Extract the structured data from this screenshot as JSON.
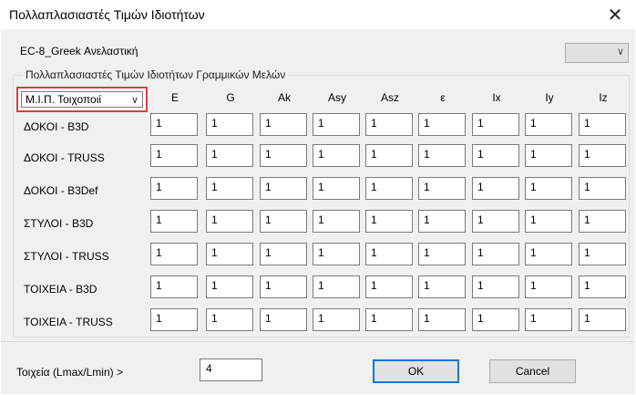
{
  "window": {
    "title": "Πολλαπλασιαστές Τιμών Ιδιοτήτων",
    "close_glyph": "✕"
  },
  "profile": {
    "label": "EC-8_Greek Ανελαστική",
    "select_value": ""
  },
  "group": {
    "legend": "Πολλαπλασιαστές Τιμών Ιδιοτήτων Γραμμικών Μελών"
  },
  "mip_select": {
    "value": "Μ.Ι.Π. Τοιχοποιί"
  },
  "columns": [
    "E",
    "G",
    "Ak",
    "Asy",
    "Asz",
    "ε",
    "Ix",
    "Iy",
    "Iz"
  ],
  "rows": [
    {
      "label": "ΔΟΚΟΙ - B3D",
      "values": [
        "1",
        "1",
        "1",
        "1",
        "1",
        "1",
        "1",
        "1",
        "1"
      ]
    },
    {
      "label": "ΔΟΚΟΙ - TRUSS",
      "values": [
        "1",
        "1",
        "1",
        "1",
        "1",
        "1",
        "1",
        "1",
        "1"
      ]
    },
    {
      "label": "ΔΟΚΟΙ - B3Def",
      "values": [
        "1",
        "1",
        "1",
        "1",
        "1",
        "1",
        "1",
        "1",
        "1"
      ]
    },
    {
      "label": "ΣΤΥΛΟΙ - B3D",
      "values": [
        "1",
        "1",
        "1",
        "1",
        "1",
        "1",
        "1",
        "1",
        "1"
      ]
    },
    {
      "label": "ΣΤΥΛΟΙ - TRUSS",
      "values": [
        "1",
        "1",
        "1",
        "1",
        "1",
        "1",
        "1",
        "1",
        "1"
      ]
    },
    {
      "label": "ΤΟΙΧΕΙΑ - B3D",
      "values": [
        "1",
        "1",
        "1",
        "1",
        "1",
        "1",
        "1",
        "1",
        "1"
      ]
    },
    {
      "label": "ΤΟΙΧΕΙΑ - TRUSS",
      "values": [
        "1",
        "1",
        "1",
        "1",
        "1",
        "1",
        "1",
        "1",
        "1"
      ]
    }
  ],
  "footer": {
    "ratio_label": "Τοιχεία (Lmax/Lmin) >",
    "ratio_value": "4",
    "ok_label": "OK",
    "cancel_label": "Cancel"
  },
  "icons": {
    "chevron": "chevron-down-icon",
    "close": "close-icon"
  },
  "colors": {
    "highlight": "#e03c3c",
    "default_button_border": "#0078d7"
  }
}
